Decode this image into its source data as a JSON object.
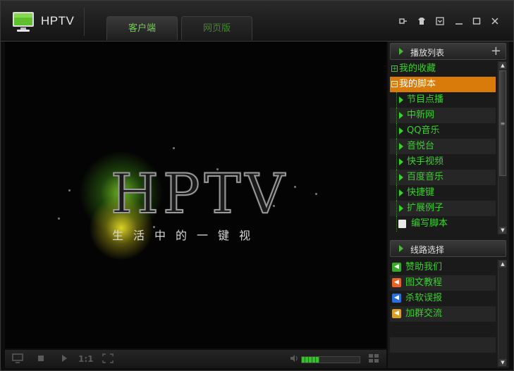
{
  "app": {
    "title": "HPTV"
  },
  "tabs": [
    {
      "label": "客户端",
      "active": true
    },
    {
      "label": "网页版",
      "active": false
    }
  ],
  "window_controls": [
    "pin-icon",
    "skin-icon",
    "menu-icon",
    "minimize-icon",
    "maximize-icon",
    "close-icon"
  ],
  "splash": {
    "logo": "HPTV",
    "slogan": "生活中的一键视"
  },
  "controls": {
    "ratio_label": "1:1",
    "volume_fraction": 0.3
  },
  "playlist": {
    "title": "播放列表",
    "items": [
      {
        "label": "我的收藏",
        "type": "folder",
        "expanded": false,
        "box": "+"
      },
      {
        "label": "我的脚本",
        "type": "folder",
        "expanded": true,
        "selected": true,
        "box": "−"
      },
      {
        "label": "节目点播",
        "type": "script"
      },
      {
        "label": "中新网",
        "type": "script"
      },
      {
        "label": "QQ音乐",
        "type": "script"
      },
      {
        "label": "音悦台",
        "type": "script"
      },
      {
        "label": "快手视频",
        "type": "script"
      },
      {
        "label": "百度音乐",
        "type": "script"
      },
      {
        "label": "快捷键",
        "type": "script"
      },
      {
        "label": "扩展例子",
        "type": "script"
      },
      {
        "label": "编写脚本",
        "type": "edit"
      }
    ]
  },
  "lines": {
    "title": "线路选择",
    "items": [
      {
        "label": "赞助我们",
        "icon": "speaker-green-icon",
        "color": "#3aa82a"
      },
      {
        "label": "图文教程",
        "icon": "speaker-orange-icon",
        "color": "#e8632a"
      },
      {
        "label": "杀软误报",
        "icon": "shield-blue-icon",
        "color": "#2a6fd8"
      },
      {
        "label": "加群交流",
        "icon": "penguin-icon",
        "color": "#d8a02a"
      }
    ]
  },
  "colors": {
    "accent_green": "#39d12b",
    "selected": "#d87b0a",
    "background": "#0d0d0d"
  }
}
